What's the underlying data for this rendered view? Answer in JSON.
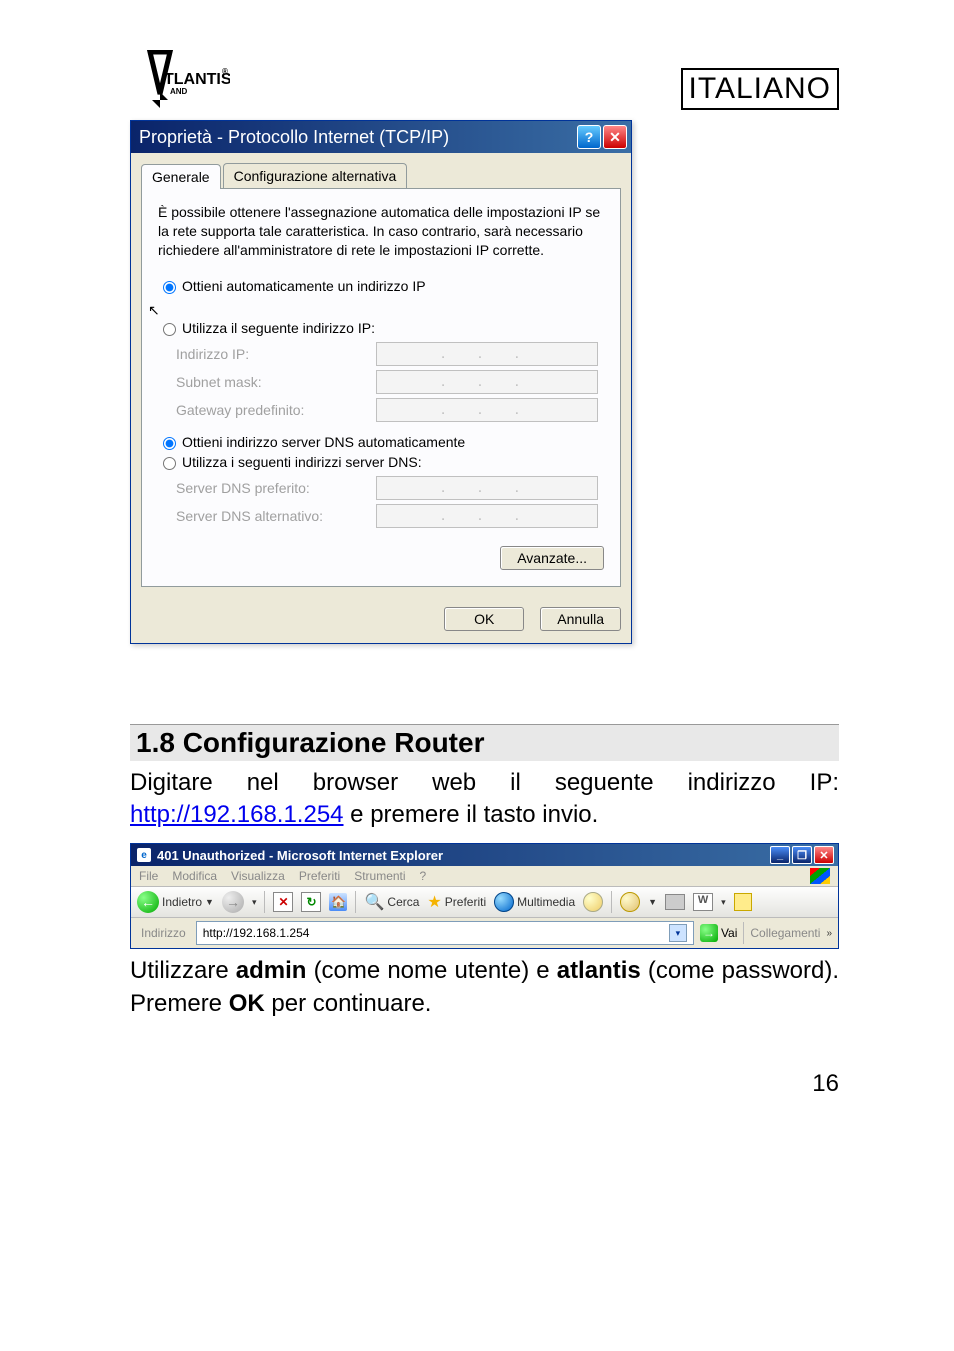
{
  "header": {
    "brand_main": "TLANTIS",
    "brand_sub": "AND",
    "brand_reg": "®",
    "lang_tag": "ITALIANO"
  },
  "dialog": {
    "title": "Proprietà - Protocollo Internet (TCP/IP)",
    "tabs": {
      "general": "Generale",
      "alt": "Configurazione alternativa"
    },
    "info": "È possibile ottenere l'assegnazione automatica delle impostazioni IP se la rete supporta tale caratteristica. In caso contrario, sarà necessario richiedere all'amministratore di rete le impostazioni IP corrette.",
    "ip_group": {
      "auto": "Ottieni automaticamente un indirizzo IP",
      "manual": "Utilizza il seguente indirizzo IP:",
      "field_ip": "Indirizzo IP:",
      "field_mask": "Subnet mask:",
      "field_gw": "Gateway predefinito:"
    },
    "dns_group": {
      "auto": "Ottieni indirizzo server DNS automaticamente",
      "manual": "Utilizza i seguenti indirizzi server DNS:",
      "field_pref": "Server DNS preferito:",
      "field_alt": "Server DNS alternativo:"
    },
    "btn_advanced": "Avanzate...",
    "btn_ok": "OK",
    "btn_cancel": "Annulla"
  },
  "section": {
    "heading": "1.8 Configurazione Router",
    "para1_a": "Digitare nel browser web il seguente indirizzo IP: ",
    "link": "http://192.168.1.254",
    "para1_b": "  e premere il tasto invio.",
    "para2_a": "Utilizzare ",
    "para2_admin": "admin",
    "para2_b": " (come nome utente) e ",
    "para2_atlantis": "atlantis",
    "para2_c": " (come password). Premere ",
    "para2_ok": "OK",
    "para2_d": " per continuare."
  },
  "ie": {
    "title": "401 Unauthorized - Microsoft Internet Explorer",
    "menus": {
      "file": "File",
      "modifica": "Modifica",
      "visualizza": "Visualizza",
      "preferiti": "Preferiti",
      "strumenti": "Strumenti",
      "help": "?"
    },
    "toolbar": {
      "back": "Indietro",
      "search": "Cerca",
      "fav": "Preferiti",
      "media": "Multimedia"
    },
    "address": {
      "label": "Indirizzo",
      "value": "http://192.168.1.254",
      "go": "Vai",
      "links": "Collegamenti"
    }
  },
  "page_number": "16"
}
